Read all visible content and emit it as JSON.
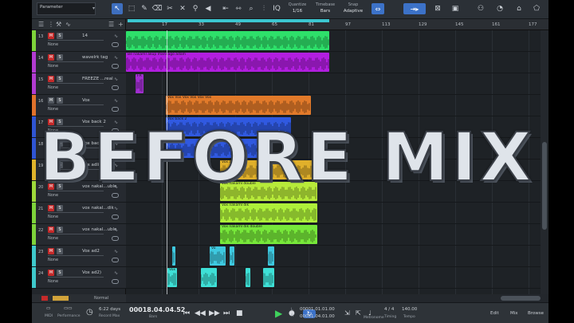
{
  "toolbar": {
    "parameter_label": "Parameter",
    "quantize_label": "Quantize",
    "quantize_value": "1/16",
    "timebase_label": "Timebase",
    "timebase_value": "Bars",
    "snap_label": "Snap",
    "snap_value": "Adaptive"
  },
  "ruler": {
    "marks": [
      "17",
      "33",
      "49",
      "65",
      "81",
      "97",
      "113",
      "129",
      "145",
      "161",
      "177"
    ]
  },
  "tracks": [
    {
      "num": "13",
      "name": "14",
      "color": "#7ed33a",
      "mute": true,
      "input": "None"
    },
    {
      "num": "14",
      "name": "wavelrk tag",
      "color": "#b23bd1",
      "mute": true,
      "input": "None"
    },
    {
      "num": "15",
      "name": "FREEZE ...real",
      "color": "#b23bd1",
      "mute": true,
      "input": "None"
    },
    {
      "num": "16",
      "name": "Vox",
      "color": "#e0722b",
      "mute": false,
      "input": "None"
    },
    {
      "num": "17",
      "name": "Vox back 2",
      "color": "#2f55d4",
      "mute": true,
      "input": "None"
    },
    {
      "num": "18",
      "name": "Vox back",
      "color": "#2f55d4",
      "mute": true,
      "input": "None"
    },
    {
      "num": "19",
      "name": "Vox adlib",
      "color": "#e0b42b",
      "mute": true,
      "input": "None"
    },
    {
      "num": "20",
      "name": "vox nakal...uble",
      "color": "#9ed93a",
      "mute": true,
      "input": "None"
    },
    {
      "num": "21",
      "name": "vox nakal...dik",
      "color": "#7ed33a",
      "mute": true,
      "input": "None"
    },
    {
      "num": "22",
      "name": "vox nakal...uble",
      "color": "#7ed33a",
      "mute": true,
      "input": "None"
    },
    {
      "num": "23",
      "name": "Vox ad2",
      "color": "#3ec9cc",
      "mute": true,
      "input": "None"
    },
    {
      "num": "24",
      "name": "Vox ad2)",
      "color": "#3ec9cc",
      "mute": true,
      "input": "None"
    }
  ],
  "clips": [
    {
      "track": 0,
      "start": 0,
      "end": 255,
      "color": "#2ee06a",
      "title": ""
    },
    {
      "track": 1,
      "start": 0,
      "end": 255,
      "color": "#b21ee0",
      "title": "Be nakaml akup mandago adam"
    },
    {
      "track": 2,
      "start": 12,
      "end": 22,
      "color": "#a12ed0",
      "title": "FR"
    },
    {
      "track": 3,
      "start": 50,
      "end": 232,
      "color": "#e27a2a",
      "title": "Vox Vox Vox Vox Vox Vox"
    },
    {
      "track": 4,
      "start": 50,
      "end": 207,
      "color": "#3059e0",
      "title": "Vox back 2"
    },
    {
      "track": 5,
      "start": 50,
      "end": 180,
      "color": "#3059e0",
      "title": "Vox back"
    },
    {
      "track": 6,
      "start": 118,
      "end": 240,
      "color": "#e0b02b",
      "title": "Vox adlib"
    },
    {
      "track": 7,
      "start": 118,
      "end": 240,
      "color": "#b7ea3a",
      "title": "Vox nakaml double"
    },
    {
      "track": 8,
      "start": 118,
      "end": 240,
      "color": "#aef03a",
      "title": "Vox nakaml dik"
    },
    {
      "track": 9,
      "start": 118,
      "end": 240,
      "color": "#77e83a",
      "title": "Vox nakaml dik double"
    },
    {
      "track": 10,
      "start": 105,
      "end": 125,
      "color": "#3ec9e0",
      "title": "Vo"
    },
    {
      "track": 10,
      "start": 58,
      "end": 62,
      "color": "#3ec9e0",
      "title": ""
    },
    {
      "track": 10,
      "start": 130,
      "end": 136,
      "color": "#3ec9e0",
      "title": ""
    },
    {
      "track": 10,
      "start": 178,
      "end": 186,
      "color": "#3ec9e0",
      "title": ""
    },
    {
      "track": 11,
      "start": 52,
      "end": 64,
      "color": "#3ee0d6",
      "title": "Vox"
    },
    {
      "track": 11,
      "start": 94,
      "end": 114,
      "color": "#3ee0d6",
      "title": ""
    },
    {
      "track": 11,
      "start": 150,
      "end": 156,
      "color": "#3ee0d6",
      "title": ""
    },
    {
      "track": 11,
      "start": 172,
      "end": 186,
      "color": "#3ee0d6",
      "title": ""
    }
  ],
  "mixbar": {
    "mode_label": "Normal"
  },
  "transport": {
    "midi_label": "MIDI",
    "performance_label": "Performance",
    "days_value": "6:22 days",
    "record_max_label": "Record Max",
    "position_value": "00018.04.04.52",
    "position_unit": "Bars",
    "loop_start": "00001.01.01.00",
    "loop_end": "00081.04.01.00",
    "signature": "4 / 4",
    "timing_label": "Timing",
    "tempo": "140.00",
    "tempo_label": "Tempo",
    "metronome_label": "Metronome",
    "edit_label": "Edit",
    "mix_label": "Mix",
    "browse_label": "Browse"
  },
  "overlay_text": "BEFORE MIX"
}
